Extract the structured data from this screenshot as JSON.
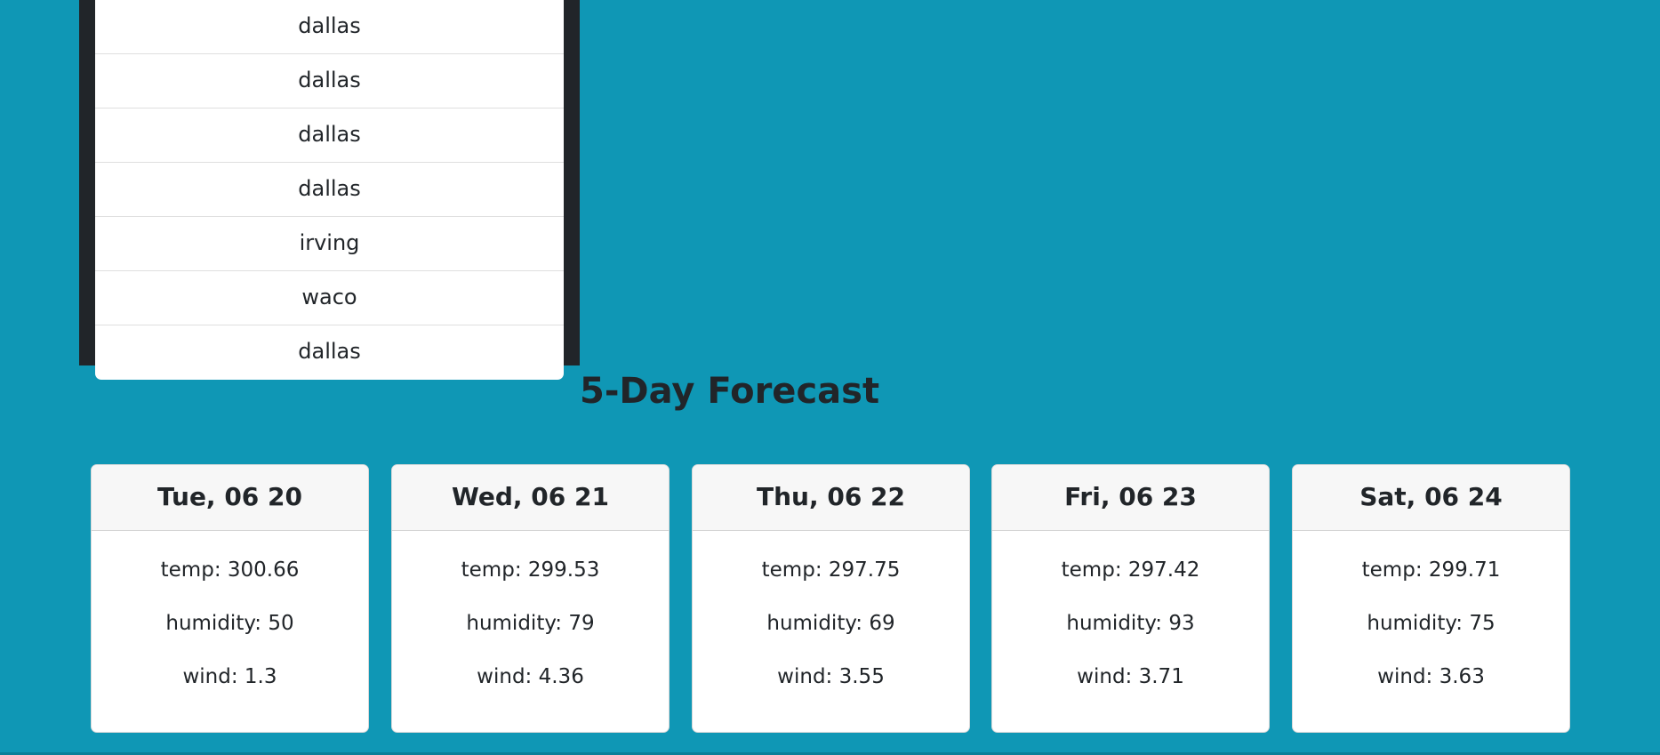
{
  "search_history": [
    "dallas",
    "dallas",
    "dallas",
    "dallas",
    "irving",
    "waco",
    "dallas"
  ],
  "forecast": {
    "title": "5-Day Forecast",
    "days": [
      {
        "date": "Tue, 06 20",
        "temp": "temp: 300.66",
        "humidity": "humidity: 50",
        "wind": "wind: 1.3"
      },
      {
        "date": "Wed, 06 21",
        "temp": "temp: 299.53",
        "humidity": "humidity: 79",
        "wind": "wind: 4.36"
      },
      {
        "date": "Thu, 06 22",
        "temp": "temp: 297.75",
        "humidity": "humidity: 69",
        "wind": "wind: 3.55"
      },
      {
        "date": "Fri, 06 23",
        "temp": "temp: 297.42",
        "humidity": "humidity: 93",
        "wind": "wind: 3.71"
      },
      {
        "date": "Sat, 06 24",
        "temp": "temp: 299.71",
        "humidity": "humidity: 75",
        "wind": "wind: 3.63"
      }
    ]
  },
  "colors": {
    "page_background": "#0f97b5",
    "panel_background": "#212529",
    "card_header_background": "#f7f7f7",
    "text": "#212529"
  }
}
